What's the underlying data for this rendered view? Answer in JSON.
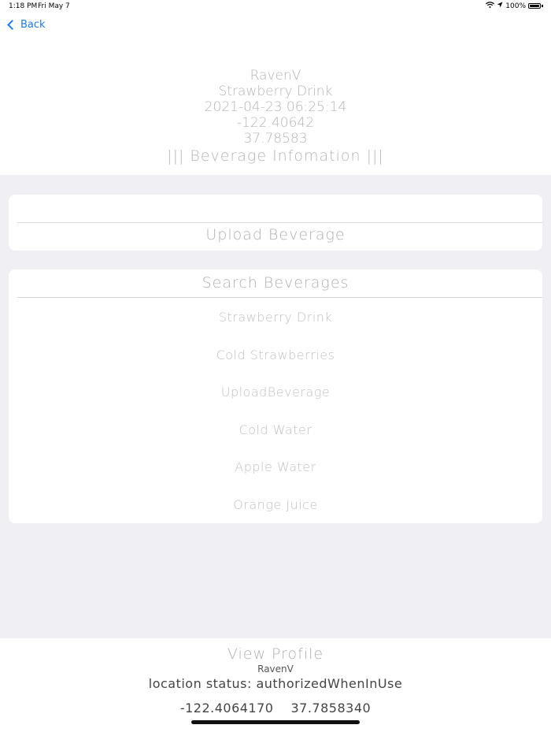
{
  "status_bar": {
    "time": "1:18 PM",
    "date": "Fri May 7",
    "battery": "100%",
    "icons": [
      "wifi-icon",
      "location-arrow-icon",
      "battery-icon"
    ]
  },
  "nav": {
    "back_label": "Back",
    "accent_color": "#1a7cf5"
  },
  "info": {
    "username": "RavenV",
    "beverage": "Strawberry Drink",
    "timestamp": "2021-04-23 06:25:14",
    "longitude": "-122.40642",
    "latitude": "37.78583",
    "title": "||| Beverage Infomation |||"
  },
  "upload": {
    "field_value": "",
    "button_label": "Upload Beverage"
  },
  "search": {
    "header_label": "Search Beverages",
    "items": [
      "Strawberry Drink",
      "Cold Strawberries",
      "UploadBeverage",
      "Cold Water",
      "Apple Water",
      "Orange Juice"
    ]
  },
  "footer": {
    "view_profile_label": "View Profile",
    "username": "RavenV",
    "location_status": "location status: authorizedWhenInUse",
    "longitude": "-122.4064170",
    "latitude": "37.7858340"
  }
}
